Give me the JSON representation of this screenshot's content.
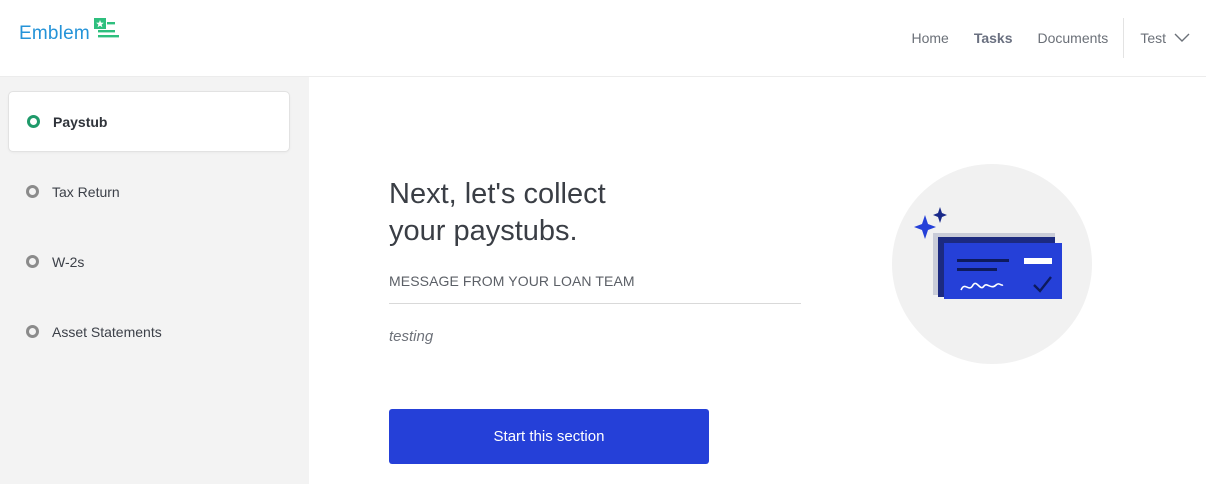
{
  "header": {
    "brand": "Emblem",
    "nav": [
      {
        "label": "Home",
        "active": false
      },
      {
        "label": "Tasks",
        "active": true
      },
      {
        "label": "Documents",
        "active": false
      }
    ],
    "user": "Test"
  },
  "sidebar": {
    "items": [
      {
        "label": "Paystub",
        "active": true
      },
      {
        "label": "Tax Return",
        "active": false
      },
      {
        "label": "W-2s",
        "active": false
      },
      {
        "label": "Asset Statements",
        "active": false
      }
    ]
  },
  "main": {
    "headline_line1": "Next, let's collect",
    "headline_line2": "your paystubs.",
    "message_title": "MESSAGE FROM YOUR LOAN TEAM",
    "message_body": "testing",
    "cta_label": "Start this section"
  },
  "colors": {
    "brand": "#2493d8",
    "brand_mark": "#2ebf7e",
    "primary_button": "#2540d8",
    "active_dot": "#1f9a6a",
    "illustration_accent": "#2540d8"
  },
  "icons": {
    "logo_mark": "star-flag-icon",
    "user_menu": "chevron-down-icon",
    "illustration": "paycheck-illustration"
  }
}
